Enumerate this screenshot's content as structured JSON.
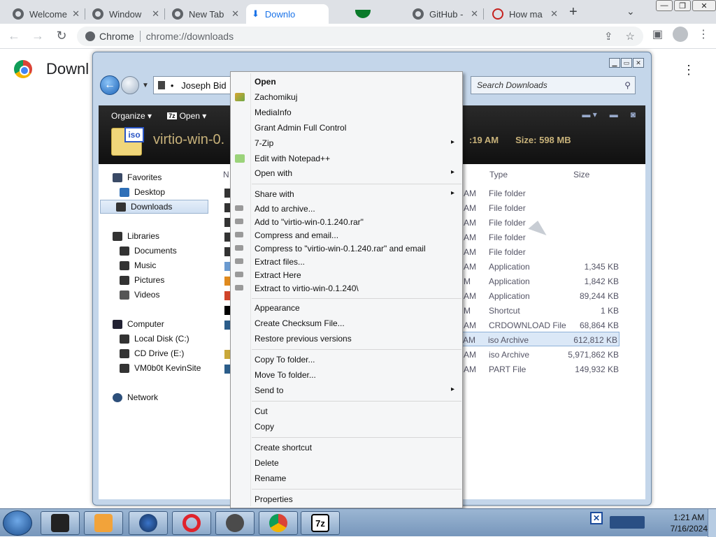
{
  "browser": {
    "tabs": [
      {
        "label": "Welcome",
        "active": false
      },
      {
        "label": "Window",
        "active": false
      },
      {
        "label": "New Tab",
        "active": false
      },
      {
        "label": "Downlo",
        "active": true
      },
      {
        "label": "",
        "active": false
      },
      {
        "label": "GitHub -",
        "active": false
      },
      {
        "label": "How ma",
        "active": false
      }
    ],
    "new_tab": "+",
    "omnibox": {
      "chip": "Chrome",
      "url": "chrome://downloads"
    }
  },
  "downloads_page": {
    "title": "Downl"
  },
  "explorer": {
    "address": "Joseph Bid",
    "search_placeholder": "Search Downloads",
    "commands": {
      "organize": "Organize",
      "open": "Open"
    },
    "preview": {
      "file_name": "virtio-win-0.",
      "time_fragment": ":19 AM",
      "size": "Size: 598 MB",
      "icon_badge": "iso"
    },
    "nav": {
      "favorites": "Favorites",
      "desktop": "Desktop",
      "downloads": "Downloads",
      "libraries": "Libraries",
      "documents": "Documents",
      "music": "Music",
      "pictures": "Pictures",
      "videos": "Videos",
      "computer": "Computer",
      "local_disk": "Local Disk (C:)",
      "cd_drive": "CD Drive (E:)",
      "vm": "VM0b0t KevinSite",
      "network": "Network"
    },
    "columns": {
      "name": "N",
      "type": "Type",
      "size": "Size"
    },
    "rows": [
      {
        "date": "AM",
        "type": "File folder",
        "size": ""
      },
      {
        "date": "AM",
        "type": "File folder",
        "size": ""
      },
      {
        "date": "AM",
        "type": "File folder",
        "size": ""
      },
      {
        "date": "AM",
        "type": "File folder",
        "size": ""
      },
      {
        "date": "AM",
        "type": "File folder",
        "size": ""
      },
      {
        "date": "AM",
        "type": "Application",
        "size": "1,345 KB"
      },
      {
        "date": "M",
        "type": "Application",
        "size": "1,842 KB"
      },
      {
        "date": "AM",
        "type": "Application",
        "size": "89,244 KB"
      },
      {
        "date": "M",
        "type": "Shortcut",
        "size": "1 KB"
      },
      {
        "date": "AM",
        "type": "CRDOWNLOAD File",
        "size": "68,864 KB"
      },
      {
        "date": "AM",
        "type": "iso Archive",
        "size": "612,812 KB"
      },
      {
        "date": "AM",
        "type": "iso Archive",
        "size": "5,971,862 KB"
      },
      {
        "date": "AM",
        "type": "PART File",
        "size": "149,932 KB"
      }
    ]
  },
  "context_menu": {
    "items": [
      {
        "label": "Open",
        "bold": true,
        "arrow": false,
        "icon": ""
      },
      {
        "label": "Zachomikuj",
        "bold": false,
        "arrow": false,
        "icon": "zachomikuj-icon"
      },
      {
        "label": "MediaInfo",
        "bold": false,
        "arrow": false,
        "icon": ""
      },
      {
        "label": "Grant Admin Full Control",
        "bold": false,
        "arrow": false,
        "icon": ""
      },
      {
        "label": "7-Zip",
        "bold": false,
        "arrow": true,
        "icon": ""
      },
      {
        "label": "Edit with Notepad++",
        "bold": false,
        "arrow": false,
        "icon": "notepad-icon"
      },
      {
        "label": "Open with",
        "bold": false,
        "arrow": true,
        "icon": ""
      },
      {
        "label": "Share with",
        "bold": false,
        "arrow": true,
        "icon": ""
      },
      {
        "label": "Add to archive...",
        "bold": false,
        "arrow": false,
        "icon": "winrar-icon"
      },
      {
        "label": "Add to \"virtio-win-0.1.240.rar\"",
        "bold": false,
        "arrow": false,
        "icon": "winrar-icon"
      },
      {
        "label": "Compress and email...",
        "bold": false,
        "arrow": false,
        "icon": "winrar-icon"
      },
      {
        "label": "Compress to \"virtio-win-0.1.240.rar\" and email",
        "bold": false,
        "arrow": false,
        "icon": "winrar-icon"
      },
      {
        "label": "Extract files...",
        "bold": false,
        "arrow": false,
        "icon": "winrar-icon"
      },
      {
        "label": "Extract Here",
        "bold": false,
        "arrow": false,
        "icon": "winrar-icon"
      },
      {
        "label": "Extract to virtio-win-0.1.240\\",
        "bold": false,
        "arrow": false,
        "icon": "winrar-icon"
      },
      {
        "label": "Appearance",
        "bold": false,
        "arrow": false,
        "icon": ""
      },
      {
        "label": "Create Checksum File...",
        "bold": false,
        "arrow": false,
        "icon": ""
      },
      {
        "label": "Restore previous versions",
        "bold": false,
        "arrow": false,
        "icon": ""
      },
      {
        "label": "Copy To folder...",
        "bold": false,
        "arrow": false,
        "icon": ""
      },
      {
        "label": "Move To folder...",
        "bold": false,
        "arrow": false,
        "icon": ""
      },
      {
        "label": "Send to",
        "bold": false,
        "arrow": true,
        "icon": ""
      },
      {
        "label": "Cut",
        "bold": false,
        "arrow": false,
        "icon": ""
      },
      {
        "label": "Copy",
        "bold": false,
        "arrow": false,
        "icon": ""
      },
      {
        "label": "Create shortcut",
        "bold": false,
        "arrow": false,
        "icon": ""
      },
      {
        "label": "Delete",
        "bold": false,
        "arrow": false,
        "icon": ""
      },
      {
        "label": "Rename",
        "bold": false,
        "arrow": false,
        "icon": ""
      },
      {
        "label": "Properties",
        "bold": false,
        "arrow": false,
        "icon": ""
      }
    ]
  },
  "taskbar": {
    "apps": [
      "file-manager",
      "media-player",
      "firefox",
      "opera",
      "game-app",
      "chrome",
      "7zip"
    ],
    "app_7zip_label": "7z",
    "time": "1:21 AM",
    "date": "7/16/2024"
  },
  "colors": {
    "chrome_accent": "#1a73e8",
    "explorer_frame": "#c4d6ea",
    "selection": "#dbe8f7"
  }
}
